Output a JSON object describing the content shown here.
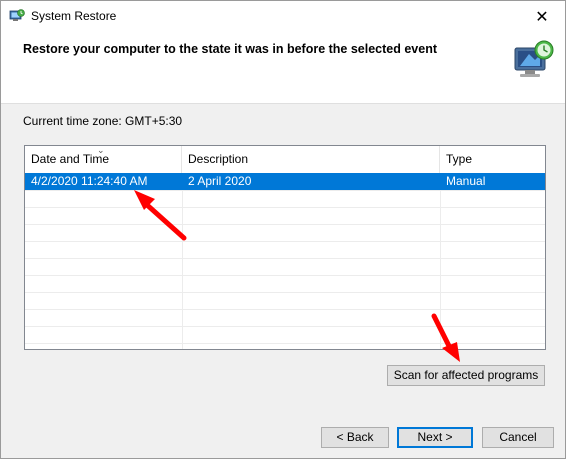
{
  "window": {
    "title": "System Restore",
    "close_glyph": "✕"
  },
  "header": {
    "title": "Restore your computer to the state it was in before the selected event",
    "icon": "system-restore-monitor-icon"
  },
  "timezone_label": "Current time zone: GMT+5:30",
  "restore_points": {
    "columns": [
      "Date and Time",
      "Description",
      "Type"
    ],
    "rows": [
      {
        "date_time": "4/2/2020 11:24:40 AM",
        "description": "2 April 2020",
        "type": "Manual",
        "selected": true
      }
    ]
  },
  "buttons": {
    "scan": "Scan for affected programs",
    "back": "< Back",
    "next": "Next >",
    "cancel": "Cancel"
  },
  "colors": {
    "selection": "#0078d7",
    "annotation_arrow": "#ff0000"
  }
}
